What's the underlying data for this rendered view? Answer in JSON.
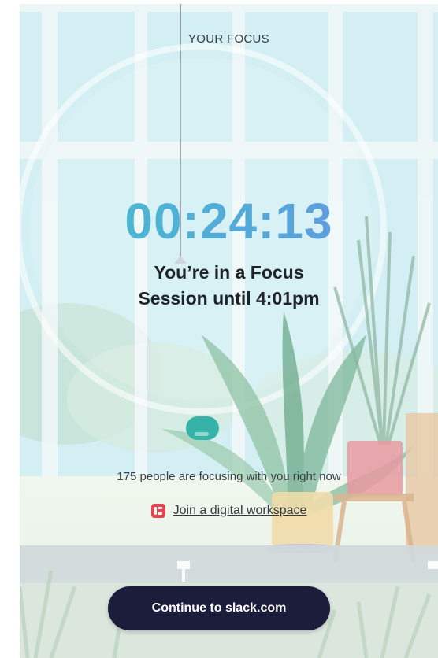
{
  "focus": {
    "label": "YOUR FOCUS",
    "timer": "00:24:13",
    "session_line1": "You’re in a Focus",
    "session_line2": "Session until 4:01pm"
  },
  "community": {
    "people_text": "175 people are focusing with you right now",
    "join_link": "Join a digital workspace",
    "icon": "slack-icon"
  },
  "actions": {
    "continue_label": "Continue to slack.com"
  },
  "colors": {
    "timer_gradient_start": "#46c0d0",
    "timer_gradient_end": "#6b8fe6",
    "button_bg": "#1b1d3a",
    "slack_icon_bg": "#e0464f"
  }
}
